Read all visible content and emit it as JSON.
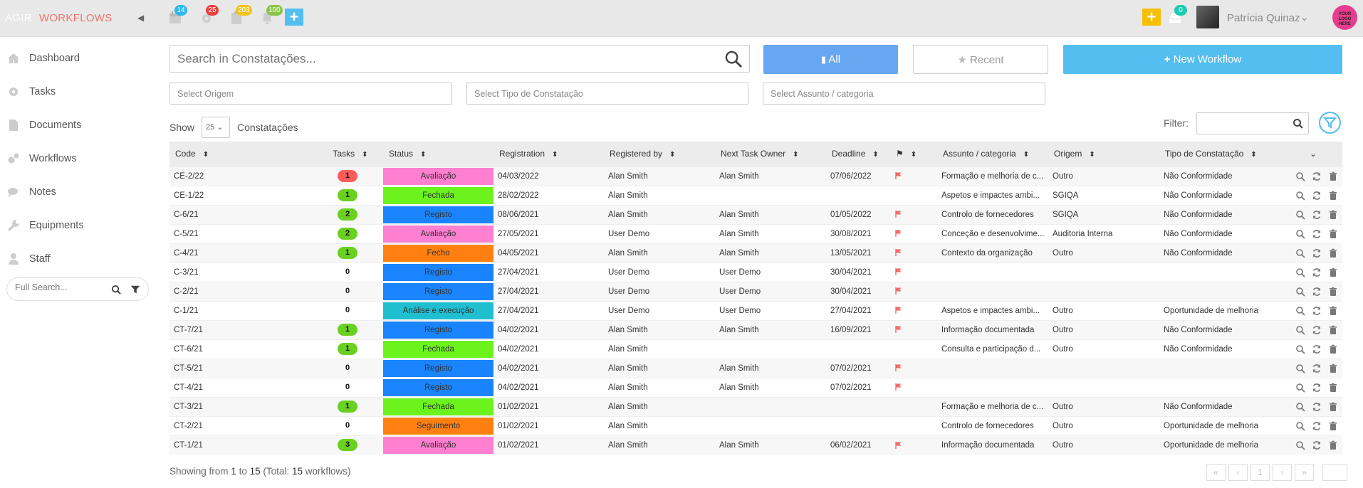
{
  "topbar": {
    "brand_agir": "AGIR",
    "brand_workflows": "WORKFLOWS",
    "badges": {
      "calendar": "14",
      "settings": "25",
      "clipboard": "203",
      "bell": "100",
      "inbox": "0"
    },
    "user_name": "Patrícia Quinaz",
    "logo_text": "YOUR LOGO HERE"
  },
  "sidebar": {
    "items": [
      {
        "label": "Dashboard",
        "icon": "home-icon"
      },
      {
        "label": "Tasks",
        "icon": "gear-icon"
      },
      {
        "label": "Documents",
        "icon": "document-icon"
      },
      {
        "label": "Workflows",
        "icon": "gears-icon"
      },
      {
        "label": "Notes",
        "icon": "comments-icon"
      },
      {
        "label": "Equipments",
        "icon": "wrench-icon"
      },
      {
        "label": "Staff",
        "icon": "user-icon"
      }
    ],
    "search_placeholder": "Full Search..."
  },
  "main": {
    "search_placeholder": "Search in Constatações...",
    "btn_all": "All",
    "btn_recent": "Recent",
    "btn_new": "New Workflow",
    "select_origem": "Select Origem",
    "select_tipo": "Select Tipo de Constatação",
    "select_assunto": "Select Assunto / categoria",
    "show_label": "Show",
    "page_size": "25",
    "entity_label": "Constatações",
    "filter_label": "Filter:"
  },
  "table": {
    "headers": {
      "code": "Code",
      "tasks": "Tasks",
      "status": "Status",
      "registration": "Registration",
      "registered_by": "Registered by",
      "next_owner": "Next Task Owner",
      "deadline": "Deadline",
      "assunto": "Assunto / categoria",
      "origem": "Origem",
      "tipo": "Tipo de Constatação"
    },
    "rows": [
      {
        "code": "CE-2/22",
        "tasks": "1",
        "status": "Avaliação",
        "registration": "04/03/2022",
        "registered_by": "Alan Smith",
        "next_owner": "Alan Smith",
        "deadline": "07/06/2022",
        "flag": true,
        "assunto": "Formação e melhoria de c...",
        "origem": "Outro",
        "tipo": "Não Conformidade"
      },
      {
        "code": "CE-1/22",
        "tasks": "1",
        "status": "Fechada",
        "registration": "28/02/2022",
        "registered_by": "Alan Smith",
        "next_owner": "",
        "deadline": "",
        "flag": false,
        "assunto": "Aspetos e impactes ambi...",
        "origem": "SGIQA",
        "tipo": "Não Conformidade"
      },
      {
        "code": "C-6/21",
        "tasks": "2",
        "status": "Registo",
        "registration": "08/06/2021",
        "registered_by": "Alan Smith",
        "next_owner": "Alan Smith",
        "deadline": "01/05/2022",
        "flag": true,
        "assunto": "Controlo de fornecedores",
        "origem": "SGIQA",
        "tipo": "Não Conformidade"
      },
      {
        "code": "C-5/21",
        "tasks": "2",
        "status": "Avaliação",
        "registration": "27/05/2021",
        "registered_by": "User Demo",
        "next_owner": "Alan Smith",
        "deadline": "30/08/2021",
        "flag": true,
        "assunto": "Conceção e desenvolvime...",
        "origem": "Auditoria Interna",
        "tipo": "Não Conformidade"
      },
      {
        "code": "C-4/21",
        "tasks": "1",
        "status": "Fecho",
        "registration": "04/05/2021",
        "registered_by": "Alan Smith",
        "next_owner": "Alan Smith",
        "deadline": "13/05/2021",
        "flag": true,
        "assunto": "Contexto da organização",
        "origem": "Outro",
        "tipo": "Não Conformidade"
      },
      {
        "code": "C-3/21",
        "tasks": "0",
        "status": "Registo",
        "registration": "27/04/2021",
        "registered_by": "User Demo",
        "next_owner": "User Demo",
        "deadline": "30/04/2021",
        "flag": true,
        "assunto": "",
        "origem": "",
        "tipo": ""
      },
      {
        "code": "C-2/21",
        "tasks": "0",
        "status": "Registo",
        "registration": "27/04/2021",
        "registered_by": "User Demo",
        "next_owner": "User Demo",
        "deadline": "30/04/2021",
        "flag": true,
        "assunto": "",
        "origem": "",
        "tipo": ""
      },
      {
        "code": "C-1/21",
        "tasks": "0",
        "status": "Análise e execução",
        "registration": "27/04/2021",
        "registered_by": "User Demo",
        "next_owner": "User Demo",
        "deadline": "27/04/2021",
        "flag": true,
        "assunto": "Aspetos e impactes ambi...",
        "origem": "Outro",
        "tipo": "Oportunidade de melhoria"
      },
      {
        "code": "CT-7/21",
        "tasks": "1",
        "status": "Registo",
        "registration": "04/02/2021",
        "registered_by": "Alan Smith",
        "next_owner": "Alan Smith",
        "deadline": "16/09/2021",
        "flag": true,
        "assunto": "Informação documentada",
        "origem": "Outro",
        "tipo": "Não Conformidade"
      },
      {
        "code": "CT-6/21",
        "tasks": "1",
        "status": "Fechada",
        "registration": "04/02/2021",
        "registered_by": "Alan Smith",
        "next_owner": "",
        "deadline": "",
        "flag": false,
        "assunto": "Consulta e participação d...",
        "origem": "Outro",
        "tipo": "Não Conformidade"
      },
      {
        "code": "CT-5/21",
        "tasks": "0",
        "status": "Registo",
        "registration": "04/02/2021",
        "registered_by": "Alan Smith",
        "next_owner": "Alan Smith",
        "deadline": "07/02/2021",
        "flag": true,
        "assunto": "",
        "origem": "",
        "tipo": ""
      },
      {
        "code": "CT-4/21",
        "tasks": "0",
        "status": "Registo",
        "registration": "04/02/2021",
        "registered_by": "Alan Smith",
        "next_owner": "Alan Smith",
        "deadline": "07/02/2021",
        "flag": true,
        "assunto": "",
        "origem": "",
        "tipo": ""
      },
      {
        "code": "CT-3/21",
        "tasks": "1",
        "status": "Fechada",
        "registration": "01/02/2021",
        "registered_by": "Alan Smith",
        "next_owner": "",
        "deadline": "",
        "flag": false,
        "assunto": "Formação e melhoria de c...",
        "origem": "Outro",
        "tipo": "Não Conformidade"
      },
      {
        "code": "CT-2/21",
        "tasks": "0",
        "status": "Seguimento",
        "registration": "01/02/2021",
        "registered_by": "Alan Smith",
        "next_owner": "",
        "deadline": "",
        "flag": false,
        "assunto": "Controlo de fornecedores",
        "origem": "Outro",
        "tipo": "Oportunidade de melhoria"
      },
      {
        "code": "CT-1/21",
        "tasks": "3",
        "status": "Avaliação",
        "registration": "01/02/2021",
        "registered_by": "Alan Smith",
        "next_owner": "Alan Smith",
        "deadline": "06/02/2021",
        "flag": true,
        "assunto": "Informação documentada",
        "origem": "Outro",
        "tipo": "Oportunidade de melhoria"
      }
    ]
  },
  "colors": {
    "Avaliação": "#ff7fd0",
    "Fechada": "#6cf21d",
    "Registo": "#1a84ff",
    "Fecho": "#ff8011",
    "Análise e execução": "#1fbfd0",
    "Seguimento": "#ff8011",
    "task_red": "#ff5c5c",
    "task_green": "#6ad021",
    "flag": "#f46a6a"
  },
  "footer": {
    "showing": "Showing from",
    "from": "1",
    "to_word": "to",
    "to": "15",
    "total": "(Total:",
    "total_count": "15",
    "workflows": "workflows)",
    "current_page": "1"
  }
}
